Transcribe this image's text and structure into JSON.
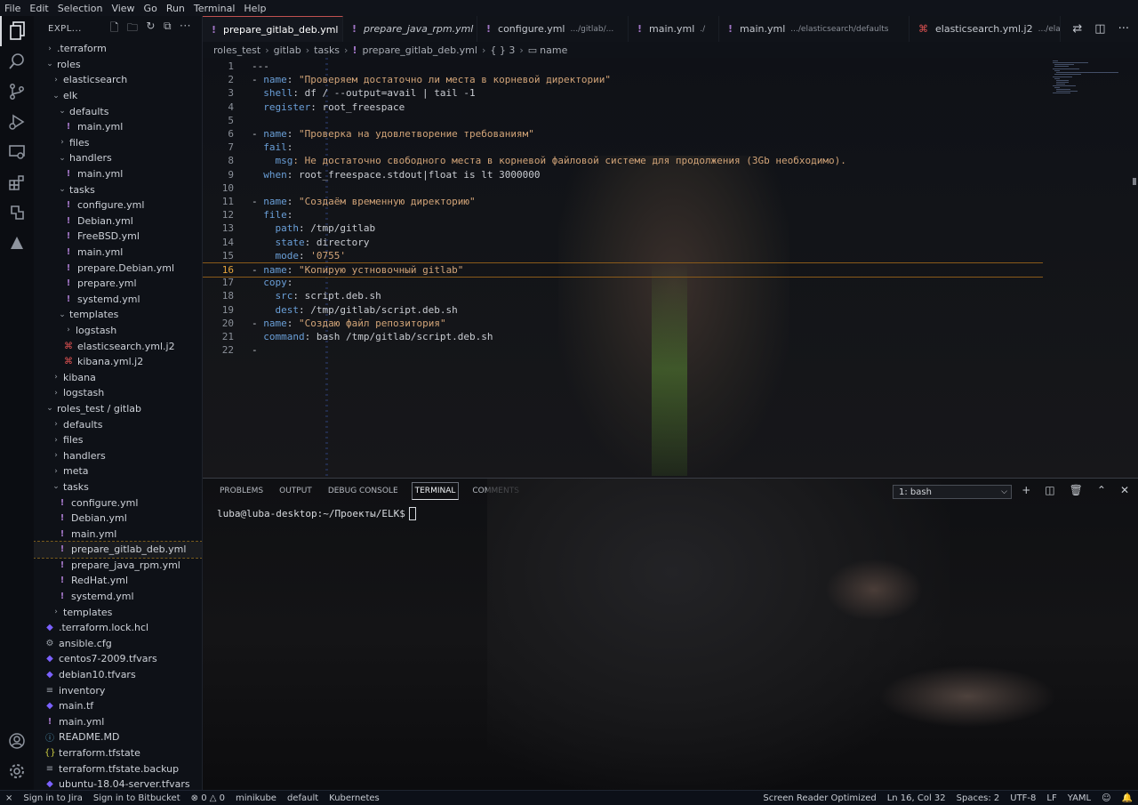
{
  "menu": [
    "File",
    "Edit",
    "Selection",
    "View",
    "Go",
    "Run",
    "Terminal",
    "Help"
  ],
  "explorer": {
    "title": "EXPL...",
    "tree": [
      {
        "label": ".terraform",
        "depth": 0,
        "type": "folder",
        "open": false
      },
      {
        "label": "roles",
        "depth": 0,
        "type": "folder",
        "open": true
      },
      {
        "label": "elasticsearch",
        "depth": 1,
        "type": "folder",
        "open": false
      },
      {
        "label": "elk",
        "depth": 1,
        "type": "folder",
        "open": true
      },
      {
        "label": "defaults",
        "depth": 2,
        "type": "folder",
        "open": true
      },
      {
        "label": "main.yml",
        "depth": 3,
        "type": "yaml"
      },
      {
        "label": "files",
        "depth": 2,
        "type": "folder",
        "open": false
      },
      {
        "label": "handlers",
        "depth": 2,
        "type": "folder",
        "open": true
      },
      {
        "label": "main.yml",
        "depth": 3,
        "type": "yaml"
      },
      {
        "label": "tasks",
        "depth": 2,
        "type": "folder",
        "open": true
      },
      {
        "label": "configure.yml",
        "depth": 3,
        "type": "yaml"
      },
      {
        "label": "Debian.yml",
        "depth": 3,
        "type": "yaml"
      },
      {
        "label": "FreeBSD.yml",
        "depth": 3,
        "type": "yaml"
      },
      {
        "label": "main.yml",
        "depth": 3,
        "type": "yaml"
      },
      {
        "label": "prepare.Debian.yml",
        "depth": 3,
        "type": "yaml"
      },
      {
        "label": "prepare.yml",
        "depth": 3,
        "type": "yaml"
      },
      {
        "label": "systemd.yml",
        "depth": 3,
        "type": "yaml"
      },
      {
        "label": "templates",
        "depth": 2,
        "type": "folder",
        "open": true
      },
      {
        "label": "logstash",
        "depth": 3,
        "type": "folder",
        "open": false
      },
      {
        "label": "elasticsearch.yml.j2",
        "depth": 3,
        "type": "j2"
      },
      {
        "label": "kibana.yml.j2",
        "depth": 3,
        "type": "j2"
      },
      {
        "label": "kibana",
        "depth": 1,
        "type": "folder",
        "open": false
      },
      {
        "label": "logstash",
        "depth": 1,
        "type": "folder",
        "open": false
      },
      {
        "label": "roles_test / gitlab",
        "depth": 0,
        "type": "folder",
        "open": true
      },
      {
        "label": "defaults",
        "depth": 1,
        "type": "folder",
        "open": false
      },
      {
        "label": "files",
        "depth": 1,
        "type": "folder",
        "open": false
      },
      {
        "label": "handlers",
        "depth": 1,
        "type": "folder",
        "open": false
      },
      {
        "label": "meta",
        "depth": 1,
        "type": "folder",
        "open": false
      },
      {
        "label": "tasks",
        "depth": 1,
        "type": "folder",
        "open": true
      },
      {
        "label": "configure.yml",
        "depth": 2,
        "type": "yaml"
      },
      {
        "label": "Debian.yml",
        "depth": 2,
        "type": "yaml"
      },
      {
        "label": "main.yml",
        "depth": 2,
        "type": "yaml"
      },
      {
        "label": "prepare_gitlab_deb.yml",
        "depth": 2,
        "type": "yaml",
        "selected": true
      },
      {
        "label": "prepare_java_rpm.yml",
        "depth": 2,
        "type": "yaml"
      },
      {
        "label": "RedHat.yml",
        "depth": 2,
        "type": "yaml"
      },
      {
        "label": "systemd.yml",
        "depth": 2,
        "type": "yaml"
      },
      {
        "label": "templates",
        "depth": 1,
        "type": "folder",
        "open": false
      },
      {
        "label": ".terraform.lock.hcl",
        "depth": 0,
        "type": "tf"
      },
      {
        "label": "ansible.cfg",
        "depth": 0,
        "type": "gear"
      },
      {
        "label": "centos7-2009.tfvars",
        "depth": 0,
        "type": "tf"
      },
      {
        "label": "debian10.tfvars",
        "depth": 0,
        "type": "tf"
      },
      {
        "label": "inventory",
        "depth": 0,
        "type": "list"
      },
      {
        "label": "main.tf",
        "depth": 0,
        "type": "tf"
      },
      {
        "label": "main.yml",
        "depth": 0,
        "type": "yaml"
      },
      {
        "label": "README.MD",
        "depth": 0,
        "type": "info"
      },
      {
        "label": "terraform.tfstate",
        "depth": 0,
        "type": "json"
      },
      {
        "label": "terraform.tfstate.backup",
        "depth": 0,
        "type": "list"
      },
      {
        "label": "ubuntu-18.04-server.tfvars",
        "depth": 0,
        "type": "tf"
      }
    ]
  },
  "tabs": [
    {
      "label": "prepare_gitlab_deb.yml",
      "desc": "",
      "type": "yaml",
      "active": true,
      "italic": false
    },
    {
      "label": "prepare_java_rpm.yml",
      "desc": "",
      "type": "yaml",
      "active": false,
      "italic": true
    },
    {
      "label": "configure.yml",
      "desc": ".../gitlab/...",
      "type": "yaml",
      "active": false,
      "italic": false
    },
    {
      "label": "main.yml",
      "desc": "./",
      "type": "yaml",
      "active": false,
      "italic": false
    },
    {
      "label": "main.yml",
      "desc": ".../elasticsearch/defaults",
      "type": "yaml",
      "active": false,
      "italic": false
    },
    {
      "label": "elasticsearch.yml.j2",
      "desc": ".../elasticsearc",
      "type": "j2",
      "active": false,
      "italic": false
    }
  ],
  "breadcrumb": {
    "parts": [
      "roles_test",
      "gitlab",
      "tasks"
    ],
    "file": "prepare_gitlab_deb.yml",
    "symbol1": "{ } 3",
    "symbol2": "name"
  },
  "editor": {
    "current_line": 16,
    "lines": [
      {
        "n": "1",
        "tokens": [
          {
            "t": "---",
            "c": "plain"
          }
        ]
      },
      {
        "n": "2",
        "tokens": [
          {
            "t": "- ",
            "c": "dash"
          },
          {
            "t": "name",
            "c": "key"
          },
          {
            "t": ": ",
            "c": "plain"
          },
          {
            "t": "\"Проверяем достаточно ли места в корневой директории\"",
            "c": "str"
          }
        ]
      },
      {
        "n": "3",
        "tokens": [
          {
            "t": "  shell",
            "c": "key"
          },
          {
            "t": ": df / --output=avail | tail -1",
            "c": "plain"
          }
        ]
      },
      {
        "n": "4",
        "tokens": [
          {
            "t": "  register",
            "c": "key"
          },
          {
            "t": ": root_freespace",
            "c": "plain"
          }
        ]
      },
      {
        "n": "5",
        "tokens": []
      },
      {
        "n": "6",
        "tokens": [
          {
            "t": "- ",
            "c": "dash"
          },
          {
            "t": "name",
            "c": "key"
          },
          {
            "t": ": ",
            "c": "plain"
          },
          {
            "t": "\"Проверка на удовлетворение требованиям\"",
            "c": "str"
          }
        ]
      },
      {
        "n": "7",
        "tokens": [
          {
            "t": "  fail",
            "c": "key"
          },
          {
            "t": ":",
            "c": "plain"
          }
        ]
      },
      {
        "n": "8",
        "tokens": [
          {
            "t": "    msg",
            "c": "key"
          },
          {
            "t": ": Не достаточно свободного места в корневой файловой системе для продолжения (3Gb необходимо).",
            "c": "str"
          }
        ]
      },
      {
        "n": "9",
        "tokens": [
          {
            "t": "  when",
            "c": "key"
          },
          {
            "t": ": root_freespace.stdout|float is lt 3000000",
            "c": "plain"
          }
        ]
      },
      {
        "n": "10",
        "tokens": []
      },
      {
        "n": "11",
        "tokens": [
          {
            "t": "- ",
            "c": "dash"
          },
          {
            "t": "name",
            "c": "key"
          },
          {
            "t": ": ",
            "c": "plain"
          },
          {
            "t": "\"Создаём временную директорию\"",
            "c": "str"
          }
        ]
      },
      {
        "n": "12",
        "tokens": [
          {
            "t": "  file",
            "c": "key"
          },
          {
            "t": ":",
            "c": "plain"
          }
        ]
      },
      {
        "n": "13",
        "tokens": [
          {
            "t": "    path",
            "c": "key"
          },
          {
            "t": ": /tmp/gitlab",
            "c": "plain"
          }
        ]
      },
      {
        "n": "14",
        "tokens": [
          {
            "t": "    state",
            "c": "key"
          },
          {
            "t": ": directory",
            "c": "plain"
          }
        ]
      },
      {
        "n": "15",
        "tokens": [
          {
            "t": "    mode",
            "c": "key"
          },
          {
            "t": ": ",
            "c": "plain"
          },
          {
            "t": "'0755'",
            "c": "str"
          }
        ]
      },
      {
        "n": "16",
        "tokens": [
          {
            "t": "- ",
            "c": "dash"
          },
          {
            "t": "name",
            "c": "key"
          },
          {
            "t": ": ",
            "c": "plain"
          },
          {
            "t": "\"Копирую устновочный gitlab\"",
            "c": "str"
          }
        ]
      },
      {
        "n": "17",
        "tokens": [
          {
            "t": "  copy",
            "c": "key"
          },
          {
            "t": ":",
            "c": "plain"
          }
        ]
      },
      {
        "n": "18",
        "tokens": [
          {
            "t": "    src",
            "c": "key"
          },
          {
            "t": ": script.deb.sh",
            "c": "plain"
          }
        ]
      },
      {
        "n": "19",
        "tokens": [
          {
            "t": "    dest",
            "c": "key"
          },
          {
            "t": ": /tmp/gitlab/script.deb.sh",
            "c": "plain"
          }
        ]
      },
      {
        "n": "20",
        "tokens": [
          {
            "t": "- ",
            "c": "dash"
          },
          {
            "t": "name",
            "c": "key"
          },
          {
            "t": ": ",
            "c": "plain"
          },
          {
            "t": "\"Создаю файл репозитория\"",
            "c": "str"
          }
        ]
      },
      {
        "n": "21",
        "tokens": [
          {
            "t": "  command",
            "c": "key"
          },
          {
            "t": ": bash /tmp/gitlab/script.deb.sh",
            "c": "plain"
          }
        ]
      },
      {
        "n": "22",
        "tokens": [
          {
            "t": "-",
            "c": "dash"
          }
        ]
      }
    ]
  },
  "panel": {
    "tabs": [
      "PROBLEMS",
      "OUTPUT",
      "DEBUG CONSOLE",
      "TERMINAL",
      "COMMENTS"
    ],
    "active_tab": "TERMINAL",
    "terminal_select": "1: bash",
    "prompt": "luba@luba-desktop:~/Проекты/ELK$"
  },
  "statusbar": {
    "left": [
      {
        "name": "remote-icon",
        "text": "⨯"
      },
      {
        "name": "jira",
        "text": "Sign in to Jira"
      },
      {
        "name": "bitbucket",
        "text": "Sign in to Bitbucket"
      },
      {
        "name": "problems",
        "text": "⊗ 0 △ 0"
      },
      {
        "name": "minikube",
        "text": "minikube"
      },
      {
        "name": "namespace",
        "text": "default"
      },
      {
        "name": "kubernetes",
        "text": "Kubernetes"
      }
    ],
    "right": [
      {
        "name": "screen-reader",
        "text": "Screen Reader Optimized"
      },
      {
        "name": "cursor-pos",
        "text": "Ln 16, Col 32"
      },
      {
        "name": "spaces",
        "text": "Spaces: 2"
      },
      {
        "name": "encoding",
        "text": "UTF-8"
      },
      {
        "name": "eol",
        "text": "LF"
      },
      {
        "name": "language",
        "text": "YAML"
      }
    ]
  },
  "colors": {
    "accent": "#e3a33c",
    "key": "#6a9fd8",
    "string": "#d2a478",
    "yaml_icon": "#a074c4"
  }
}
